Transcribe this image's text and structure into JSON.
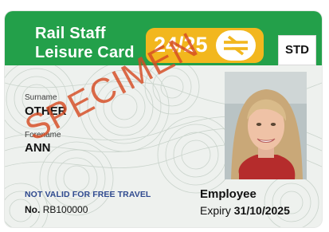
{
  "card": {
    "title_line1": "Rail Staff",
    "title_line2": "Leisure Card",
    "year": "24/25",
    "logo_icon": "national-rail-double-arrow-icon",
    "category": "STD",
    "surname_label": "Surname",
    "surname": "OTHER",
    "forename_label": "Forename",
    "forename": "ANN",
    "watermark": "SPECIMEN",
    "notice": "NOT VALID FOR FREE TRAVEL",
    "number_prefix": "No.",
    "number": "RB100000",
    "role": "Employee",
    "expiry_label": "Expiry",
    "expiry_date": "31/10/2025"
  },
  "colors": {
    "header_green": "#23a04a",
    "badge_yellow": "#f2b71e",
    "watermark_orange": "#d64a22",
    "notice_blue": "#2f4a8f"
  }
}
